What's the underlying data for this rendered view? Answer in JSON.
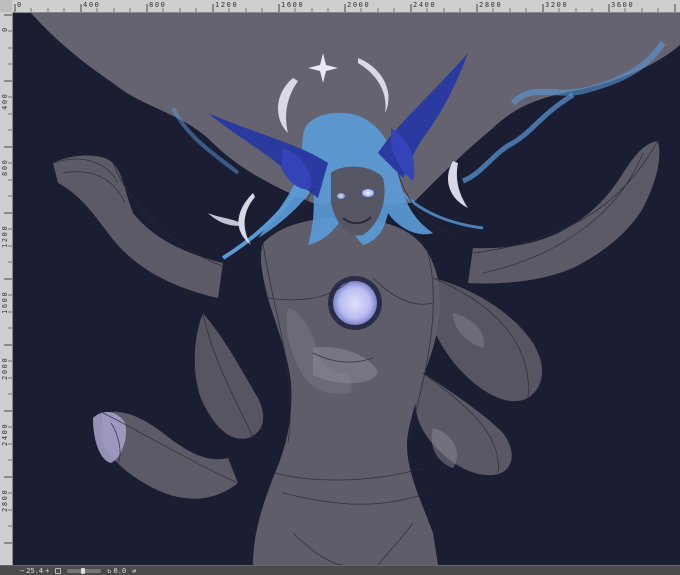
{
  "rulers": {
    "top_labels": [
      "400",
      "800",
      "1200",
      "1600",
      "2000",
      "2400",
      "2800",
      "3200",
      "3600"
    ],
    "left_labels": [
      "400",
      "800",
      "1200",
      "1600",
      "2000",
      "2400",
      "2800"
    ],
    "origin_label": "0"
  },
  "canvas": {
    "background_color": "#1b1d33",
    "figure_color": "#5c5a66",
    "cloak_color": "#6a6775",
    "hair_color": "#5a9ad6",
    "horn_color": "#2b3a9e",
    "glow_color": "#c9cbf2"
  },
  "statusbar": {
    "zoom": "25.4",
    "angle": "0.0"
  },
  "icons": [
    "zoom-out-icon",
    "zoom-in-icon",
    "rotate-icon",
    "fit-icon",
    "flip-icon"
  ]
}
